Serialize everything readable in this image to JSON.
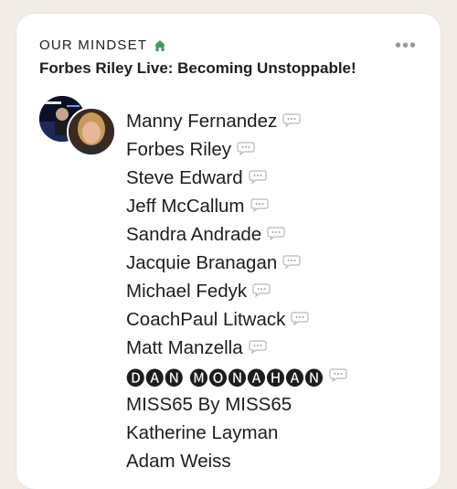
{
  "section": {
    "label": "OUR MINDSET",
    "icon": "house-icon"
  },
  "menu": {
    "icon": "more-dots-icon",
    "label": "•••"
  },
  "event": {
    "title": "Forbes Riley Live: Becoming Unstoppable!"
  },
  "host_avatars": [
    {
      "name": "show-cover-avatar",
      "description_hidden": true
    },
    {
      "name": "host-portrait-avatar",
      "description_hidden": true
    }
  ],
  "attendees": [
    {
      "name": "Manny Fernandez",
      "chat_icon": true
    },
    {
      "name": "Forbes Riley",
      "chat_icon": true
    },
    {
      "name": "Steve Edward",
      "chat_icon": true
    },
    {
      "name": "Jeff McCallum",
      "chat_icon": true
    },
    {
      "name": "Sandra Andrade",
      "chat_icon": true
    },
    {
      "name": "Jacquie Branagan",
      "chat_icon": true
    },
    {
      "name": "Michael Fedyk",
      "chat_icon": true
    },
    {
      "name": "CoachPaul Litwack",
      "chat_icon": true
    },
    {
      "name": "Matt Manzella",
      "chat_icon": true
    },
    {
      "name": "🅓🅐🅝 🅜🅞🅝🅐🅗🅐🅝",
      "chat_icon": true
    },
    {
      "name": "MISS65 By MISS65",
      "chat_icon": false
    },
    {
      "name": "Katherine Layman",
      "chat_icon": false
    },
    {
      "name": "Adam Weiss",
      "chat_icon": false
    }
  ],
  "colors": {
    "background": "#f1ece5",
    "card": "#ffffff",
    "accent_green": "#3f9a5b",
    "icon_gray": "#9a9a9a"
  }
}
